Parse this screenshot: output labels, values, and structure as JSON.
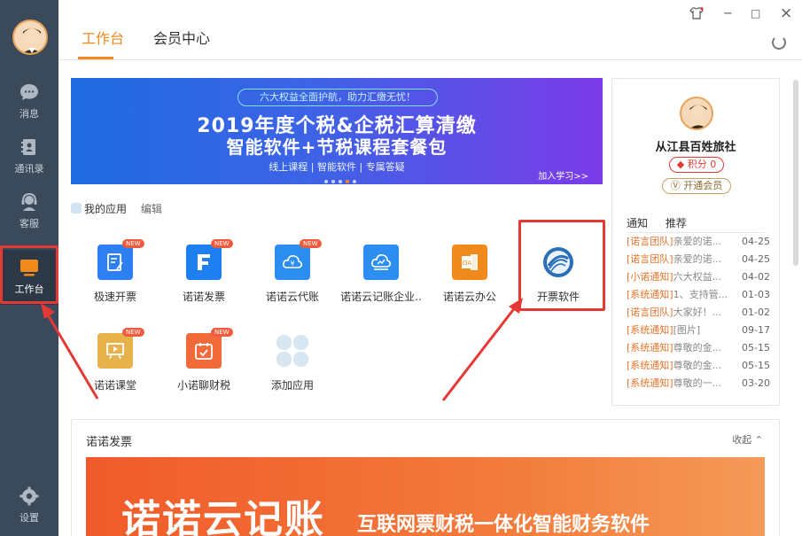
{
  "nav": {
    "items": [
      {
        "label": "消息"
      },
      {
        "label": "通讯录"
      },
      {
        "label": "客服"
      },
      {
        "label": "工作台"
      },
      {
        "label": "设置"
      }
    ]
  },
  "top": {
    "tabs": [
      {
        "label": "工作台"
      },
      {
        "label": "会员中心"
      }
    ],
    "controls": {
      "minimize": "−",
      "maximize": "□",
      "close": "×"
    }
  },
  "banner": {
    "pill": "六大权益全面护航，助力汇缴无忧！",
    "line1": "2019年度个税&企税汇算清缴",
    "line2": "智能软件+节税课程套餐包",
    "line3": "线上课程 | 智能软件 | 专属答疑",
    "more": "加入学习>>"
  },
  "apps": {
    "header": "我的应用",
    "edit": "编辑",
    "items": [
      {
        "label": "极速开票",
        "new": "NEW",
        "color": "#2e7ff2"
      },
      {
        "label": "诺诺发票",
        "new": "NEW",
        "color": "#1e7ff0"
      },
      {
        "label": "诺诺云代账",
        "new": "NEW",
        "color": "#2b8ef0"
      },
      {
        "label": "诺诺云记账企业..",
        "new": "",
        "color": "#2b8ef0"
      },
      {
        "label": "诺诺云办公",
        "new": "",
        "color": "#f08a1d"
      },
      {
        "label": "开票软件",
        "new": "",
        "color": "#2a6fb8"
      },
      {
        "label": "诺诺课堂",
        "new": "NEW",
        "color": "#e8b24a"
      },
      {
        "label": "小诺聊财税",
        "new": "NEW",
        "color": "#f06a3a"
      },
      {
        "label": "添加应用",
        "new": "",
        "color": "#d6e6f2"
      }
    ]
  },
  "profile": {
    "name": "从江县百姓旅社",
    "points": "积分 0",
    "vip": "开通会员"
  },
  "notices": {
    "tabs": [
      "通知",
      "推荐"
    ],
    "items": [
      {
        "tag": "[诺言团队]",
        "text": "亲爱的诺...",
        "date": "04-25"
      },
      {
        "tag": "[诺言团队]",
        "text": "亲爱的诺...",
        "date": "04-25"
      },
      {
        "tag": "[小诺通知]",
        "text": "六大权益...",
        "date": "04-02"
      },
      {
        "tag": "[系统通知]",
        "text": "1、支持管...",
        "date": "01-03"
      },
      {
        "tag": "[诺言团队]",
        "text": "大家好！...",
        "date": "01-02"
      },
      {
        "tag": "[系统通知]",
        "text": "[图片]",
        "date": "09-17"
      },
      {
        "tag": "[系统通知]",
        "text": "尊敬的金...",
        "date": "05-15"
      },
      {
        "tag": "[系统通知]",
        "text": "尊敬的金...",
        "date": "05-15"
      },
      {
        "tag": "[系统通知]",
        "text": "尊敬的一...",
        "date": "03-20"
      }
    ]
  },
  "section": {
    "title": "诺诺发票",
    "collapse": "收起 ⌃",
    "banner_big": "诺诺云记账",
    "banner_sub": "互联网票财税一体化智能财务软件"
  },
  "colors": {
    "accent": "#f08a1d",
    "highlight_red": "#e53935"
  }
}
